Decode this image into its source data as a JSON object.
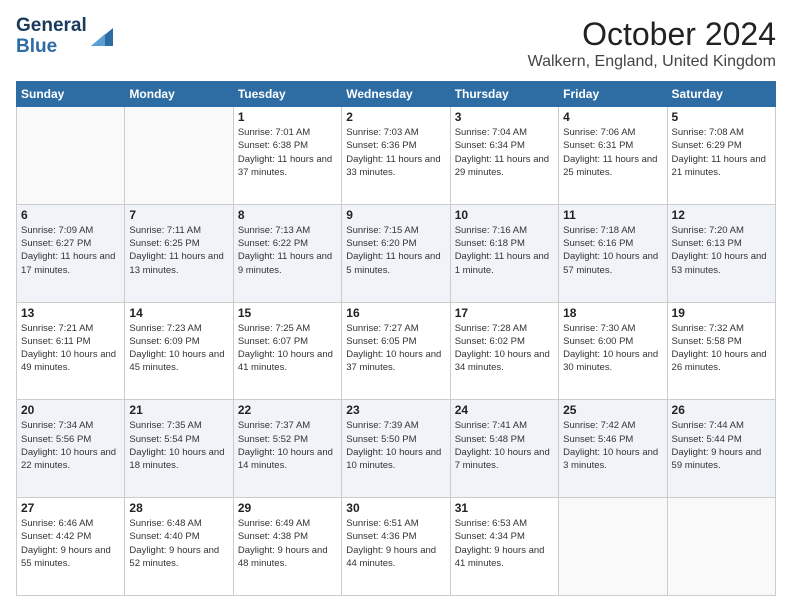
{
  "logo": {
    "line1": "General",
    "line2": "Blue"
  },
  "header": {
    "month": "October 2024",
    "location": "Walkern, England, United Kingdom"
  },
  "days_of_week": [
    "Sunday",
    "Monday",
    "Tuesday",
    "Wednesday",
    "Thursday",
    "Friday",
    "Saturday"
  ],
  "weeks": [
    [
      {
        "day": "",
        "info": ""
      },
      {
        "day": "",
        "info": ""
      },
      {
        "day": "1",
        "info": "Sunrise: 7:01 AM\nSunset: 6:38 PM\nDaylight: 11 hours and 37 minutes."
      },
      {
        "day": "2",
        "info": "Sunrise: 7:03 AM\nSunset: 6:36 PM\nDaylight: 11 hours and 33 minutes."
      },
      {
        "day": "3",
        "info": "Sunrise: 7:04 AM\nSunset: 6:34 PM\nDaylight: 11 hours and 29 minutes."
      },
      {
        "day": "4",
        "info": "Sunrise: 7:06 AM\nSunset: 6:31 PM\nDaylight: 11 hours and 25 minutes."
      },
      {
        "day": "5",
        "info": "Sunrise: 7:08 AM\nSunset: 6:29 PM\nDaylight: 11 hours and 21 minutes."
      }
    ],
    [
      {
        "day": "6",
        "info": "Sunrise: 7:09 AM\nSunset: 6:27 PM\nDaylight: 11 hours and 17 minutes."
      },
      {
        "day": "7",
        "info": "Sunrise: 7:11 AM\nSunset: 6:25 PM\nDaylight: 11 hours and 13 minutes."
      },
      {
        "day": "8",
        "info": "Sunrise: 7:13 AM\nSunset: 6:22 PM\nDaylight: 11 hours and 9 minutes."
      },
      {
        "day": "9",
        "info": "Sunrise: 7:15 AM\nSunset: 6:20 PM\nDaylight: 11 hours and 5 minutes."
      },
      {
        "day": "10",
        "info": "Sunrise: 7:16 AM\nSunset: 6:18 PM\nDaylight: 11 hours and 1 minute."
      },
      {
        "day": "11",
        "info": "Sunrise: 7:18 AM\nSunset: 6:16 PM\nDaylight: 10 hours and 57 minutes."
      },
      {
        "day": "12",
        "info": "Sunrise: 7:20 AM\nSunset: 6:13 PM\nDaylight: 10 hours and 53 minutes."
      }
    ],
    [
      {
        "day": "13",
        "info": "Sunrise: 7:21 AM\nSunset: 6:11 PM\nDaylight: 10 hours and 49 minutes."
      },
      {
        "day": "14",
        "info": "Sunrise: 7:23 AM\nSunset: 6:09 PM\nDaylight: 10 hours and 45 minutes."
      },
      {
        "day": "15",
        "info": "Sunrise: 7:25 AM\nSunset: 6:07 PM\nDaylight: 10 hours and 41 minutes."
      },
      {
        "day": "16",
        "info": "Sunrise: 7:27 AM\nSunset: 6:05 PM\nDaylight: 10 hours and 37 minutes."
      },
      {
        "day": "17",
        "info": "Sunrise: 7:28 AM\nSunset: 6:02 PM\nDaylight: 10 hours and 34 minutes."
      },
      {
        "day": "18",
        "info": "Sunrise: 7:30 AM\nSunset: 6:00 PM\nDaylight: 10 hours and 30 minutes."
      },
      {
        "day": "19",
        "info": "Sunrise: 7:32 AM\nSunset: 5:58 PM\nDaylight: 10 hours and 26 minutes."
      }
    ],
    [
      {
        "day": "20",
        "info": "Sunrise: 7:34 AM\nSunset: 5:56 PM\nDaylight: 10 hours and 22 minutes."
      },
      {
        "day": "21",
        "info": "Sunrise: 7:35 AM\nSunset: 5:54 PM\nDaylight: 10 hours and 18 minutes."
      },
      {
        "day": "22",
        "info": "Sunrise: 7:37 AM\nSunset: 5:52 PM\nDaylight: 10 hours and 14 minutes."
      },
      {
        "day": "23",
        "info": "Sunrise: 7:39 AM\nSunset: 5:50 PM\nDaylight: 10 hours and 10 minutes."
      },
      {
        "day": "24",
        "info": "Sunrise: 7:41 AM\nSunset: 5:48 PM\nDaylight: 10 hours and 7 minutes."
      },
      {
        "day": "25",
        "info": "Sunrise: 7:42 AM\nSunset: 5:46 PM\nDaylight: 10 hours and 3 minutes."
      },
      {
        "day": "26",
        "info": "Sunrise: 7:44 AM\nSunset: 5:44 PM\nDaylight: 9 hours and 59 minutes."
      }
    ],
    [
      {
        "day": "27",
        "info": "Sunrise: 6:46 AM\nSunset: 4:42 PM\nDaylight: 9 hours and 55 minutes."
      },
      {
        "day": "28",
        "info": "Sunrise: 6:48 AM\nSunset: 4:40 PM\nDaylight: 9 hours and 52 minutes."
      },
      {
        "day": "29",
        "info": "Sunrise: 6:49 AM\nSunset: 4:38 PM\nDaylight: 9 hours and 48 minutes."
      },
      {
        "day": "30",
        "info": "Sunrise: 6:51 AM\nSunset: 4:36 PM\nDaylight: 9 hours and 44 minutes."
      },
      {
        "day": "31",
        "info": "Sunrise: 6:53 AM\nSunset: 4:34 PM\nDaylight: 9 hours and 41 minutes."
      },
      {
        "day": "",
        "info": ""
      },
      {
        "day": "",
        "info": ""
      }
    ]
  ]
}
